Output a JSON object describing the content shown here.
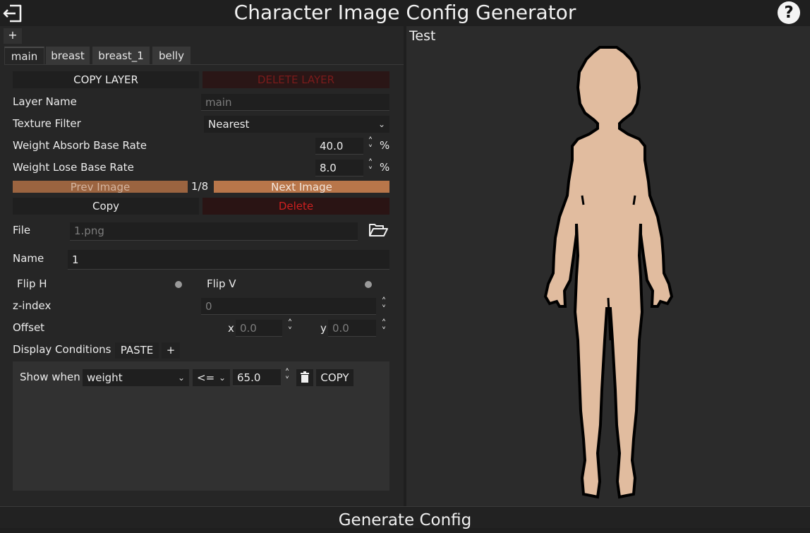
{
  "app": {
    "title": "Character Image Config Generator",
    "help_label": "?"
  },
  "tabs": {
    "add_label": "+",
    "items": [
      "main",
      "breast",
      "breast_1",
      "belly"
    ]
  },
  "layer": {
    "copy_label": "COPY LAYER",
    "delete_label": "DELETE LAYER",
    "name_label": "Layer Name",
    "name_placeholder": "main",
    "texture_filter_label": "Texture Filter",
    "texture_filter_value": "Nearest",
    "absorb_label": "Weight Absorb Base Rate",
    "absorb_value": "40.0",
    "lose_label": "Weight Lose Base Rate",
    "lose_value": "8.0",
    "percent": "%"
  },
  "image_nav": {
    "prev_label": "Prev Image",
    "counter": "1/8",
    "next_label": "Next Image"
  },
  "image": {
    "copy_label": "Copy",
    "delete_label": "Delete",
    "file_label": "File",
    "file_placeholder": "1.png",
    "name_label": "Name",
    "name_value": "1",
    "flip_h_label": "Flip H",
    "flip_v_label": "Flip V",
    "flip_h_on": false,
    "flip_v_on": false,
    "zindex_label": "z-index",
    "zindex_placeholder": "0",
    "offset_label": "Offset",
    "offset_x_label": "x",
    "offset_x_placeholder": "0.0",
    "offset_y_label": "y",
    "offset_y_placeholder": "0.0"
  },
  "conditions": {
    "label": "Display Conditions",
    "paste_label": "PASTE",
    "add_label": "+",
    "rows": [
      {
        "prefix": "Show when",
        "variable": "weight",
        "operator": "<=",
        "value": "65.0",
        "copy_label": "COPY"
      }
    ]
  },
  "preview": {
    "title": "Test",
    "skin_color": "#e1bc9f",
    "outline_color": "#000000"
  },
  "footer": {
    "generate_label": "Generate Config"
  }
}
